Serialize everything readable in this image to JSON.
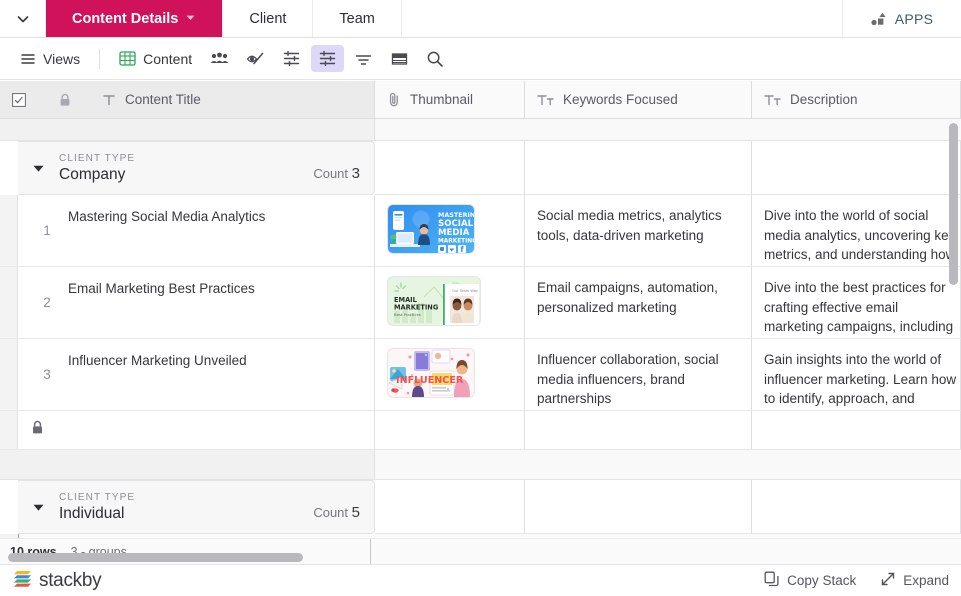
{
  "tabbar": {
    "caret_icon": "chevron-down-icon",
    "tabs": [
      {
        "label": "Content Details",
        "active": true,
        "caret": "caret-down-icon"
      },
      {
        "label": "Client",
        "active": false
      },
      {
        "label": "Team",
        "active": false
      }
    ],
    "apps_label": "APPS",
    "apps_icon": "apps-icon",
    "active_color": "#cf1259"
  },
  "toolbar": {
    "views_label": "Views",
    "views_icon": "hamburger-icon",
    "view_name": "Content",
    "view_icon": "grid-icon",
    "collaborators_icon": "collaborators-icon",
    "hide_fields_icon": "eye-slash-icon",
    "filter_icon": "filter-sliders-icon",
    "group_icon": "group-sliders-icon",
    "sort_icon": "sort-icon",
    "row_height_icon": "row-height-icon",
    "search_icon": "search-icon"
  },
  "grid": {
    "columns": [
      {
        "label": "Content Title",
        "icon": "text-field-icon",
        "lock_icon": "lock-icon",
        "select_icon": "checkbox-icon"
      },
      {
        "label": "Thumbnail",
        "icon": "attachment-icon"
      },
      {
        "label": "Keywords Focused",
        "icon": "long-text-icon"
      },
      {
        "label": "Description",
        "icon": "long-text-icon"
      }
    ],
    "groups": [
      {
        "field_label": "Client Type",
        "value": "Company",
        "count_label": "Count",
        "count": "3",
        "collapse_icon": "triangle-down-icon",
        "rows": [
          {
            "num": "1",
            "title": "Mastering Social Media Analytics",
            "thumbnail": "mastering-social-media-marketing-thumbnail",
            "keywords": "Social media metrics, analytics tools, data-driven marketing",
            "description_lines": [
              "Dive into the world of social",
              "media analytics, uncovering key",
              "metrics, and understanding how"
            ]
          },
          {
            "num": "2",
            "title": "Email Marketing Best Practices",
            "thumbnail": "email-marketing-best-practices-thumbnail",
            "keywords": "Email campaigns, automation, personalized marketing",
            "description_lines": [
              "Dive into the best practices for",
              "crafting effective email",
              "marketing campaigns, including"
            ]
          },
          {
            "num": "3",
            "title": "Influencer Marketing Unveiled",
            "thumbnail": "influencer-marketing-thumbnail",
            "keywords": "Influencer collaboration, social media influencers, brand partnerships",
            "description_lines": [
              "Gain insights into the world of",
              "influencer marketing. Learn how",
              "to identify, approach, and"
            ]
          }
        ],
        "add_row_icon": "lock-icon"
      },
      {
        "field_label": "Client Type",
        "value": "Individual",
        "count_label": "Count",
        "count": "5",
        "collapse_icon": "triangle-down-icon",
        "rows": []
      }
    ]
  },
  "statusbar": {
    "rows_text": "10 rows",
    "groups_text": "3 - groups"
  },
  "footer": {
    "brand_name": "stackby",
    "brand_icon": "stackby-logo",
    "copy_stack_label": "Copy Stack",
    "copy_stack_icon": "copy-icon",
    "expand_label": "Expand",
    "expand_icon": "expand-arrows-icon"
  }
}
